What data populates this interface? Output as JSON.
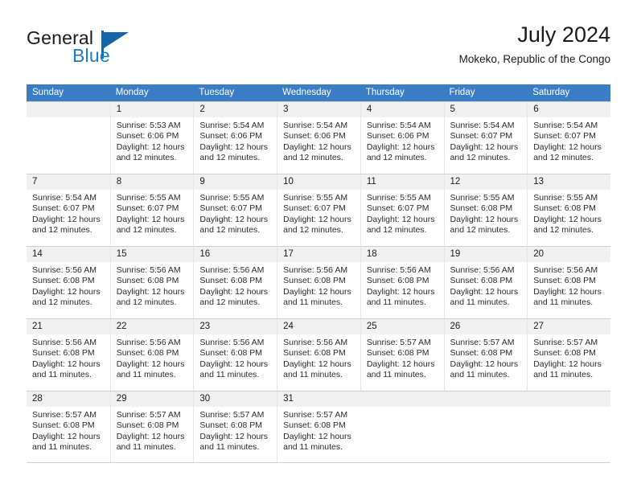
{
  "brand": {
    "name_part1": "General",
    "name_part2": "Blue",
    "logo_icon": "triangle-logo-icon"
  },
  "header": {
    "title": "July 2024",
    "subtitle": "Mokeko, Republic of the Congo"
  },
  "colors": {
    "header_row_background": "#3b7dc4",
    "day_number_background": "#f1f1f1",
    "brand_blue": "#1f7ac4",
    "logo_blue": "#1565a8",
    "text": "#1a1a1a",
    "grid_line": "#d0d0d0"
  },
  "weekday_headers": [
    "Sunday",
    "Monday",
    "Tuesday",
    "Wednesday",
    "Thursday",
    "Friday",
    "Saturday"
  ],
  "labels": {
    "sunrise_prefix": "Sunrise:",
    "sunset_prefix": "Sunset:",
    "daylight_prefix": "Daylight:"
  },
  "weeks": [
    [
      {
        "empty": true
      },
      {
        "day": "1",
        "sunrise": "Sunrise: 5:53 AM",
        "sunset": "Sunset: 6:06 PM",
        "daylight_line1": "Daylight: 12 hours",
        "daylight_line2": "and 12 minutes."
      },
      {
        "day": "2",
        "sunrise": "Sunrise: 5:54 AM",
        "sunset": "Sunset: 6:06 PM",
        "daylight_line1": "Daylight: 12 hours",
        "daylight_line2": "and 12 minutes."
      },
      {
        "day": "3",
        "sunrise": "Sunrise: 5:54 AM",
        "sunset": "Sunset: 6:06 PM",
        "daylight_line1": "Daylight: 12 hours",
        "daylight_line2": "and 12 minutes."
      },
      {
        "day": "4",
        "sunrise": "Sunrise: 5:54 AM",
        "sunset": "Sunset: 6:06 PM",
        "daylight_line1": "Daylight: 12 hours",
        "daylight_line2": "and 12 minutes."
      },
      {
        "day": "5",
        "sunrise": "Sunrise: 5:54 AM",
        "sunset": "Sunset: 6:07 PM",
        "daylight_line1": "Daylight: 12 hours",
        "daylight_line2": "and 12 minutes."
      },
      {
        "day": "6",
        "sunrise": "Sunrise: 5:54 AM",
        "sunset": "Sunset: 6:07 PM",
        "daylight_line1": "Daylight: 12 hours",
        "daylight_line2": "and 12 minutes."
      }
    ],
    [
      {
        "day": "7",
        "sunrise": "Sunrise: 5:54 AM",
        "sunset": "Sunset: 6:07 PM",
        "daylight_line1": "Daylight: 12 hours",
        "daylight_line2": "and 12 minutes."
      },
      {
        "day": "8",
        "sunrise": "Sunrise: 5:55 AM",
        "sunset": "Sunset: 6:07 PM",
        "daylight_line1": "Daylight: 12 hours",
        "daylight_line2": "and 12 minutes."
      },
      {
        "day": "9",
        "sunrise": "Sunrise: 5:55 AM",
        "sunset": "Sunset: 6:07 PM",
        "daylight_line1": "Daylight: 12 hours",
        "daylight_line2": "and 12 minutes."
      },
      {
        "day": "10",
        "sunrise": "Sunrise: 5:55 AM",
        "sunset": "Sunset: 6:07 PM",
        "daylight_line1": "Daylight: 12 hours",
        "daylight_line2": "and 12 minutes."
      },
      {
        "day": "11",
        "sunrise": "Sunrise: 5:55 AM",
        "sunset": "Sunset: 6:07 PM",
        "daylight_line1": "Daylight: 12 hours",
        "daylight_line2": "and 12 minutes."
      },
      {
        "day": "12",
        "sunrise": "Sunrise: 5:55 AM",
        "sunset": "Sunset: 6:08 PM",
        "daylight_line1": "Daylight: 12 hours",
        "daylight_line2": "and 12 minutes."
      },
      {
        "day": "13",
        "sunrise": "Sunrise: 5:55 AM",
        "sunset": "Sunset: 6:08 PM",
        "daylight_line1": "Daylight: 12 hours",
        "daylight_line2": "and 12 minutes."
      }
    ],
    [
      {
        "day": "14",
        "sunrise": "Sunrise: 5:56 AM",
        "sunset": "Sunset: 6:08 PM",
        "daylight_line1": "Daylight: 12 hours",
        "daylight_line2": "and 12 minutes."
      },
      {
        "day": "15",
        "sunrise": "Sunrise: 5:56 AM",
        "sunset": "Sunset: 6:08 PM",
        "daylight_line1": "Daylight: 12 hours",
        "daylight_line2": "and 12 minutes."
      },
      {
        "day": "16",
        "sunrise": "Sunrise: 5:56 AM",
        "sunset": "Sunset: 6:08 PM",
        "daylight_line1": "Daylight: 12 hours",
        "daylight_line2": "and 12 minutes."
      },
      {
        "day": "17",
        "sunrise": "Sunrise: 5:56 AM",
        "sunset": "Sunset: 6:08 PM",
        "daylight_line1": "Daylight: 12 hours",
        "daylight_line2": "and 11 minutes."
      },
      {
        "day": "18",
        "sunrise": "Sunrise: 5:56 AM",
        "sunset": "Sunset: 6:08 PM",
        "daylight_line1": "Daylight: 12 hours",
        "daylight_line2": "and 11 minutes."
      },
      {
        "day": "19",
        "sunrise": "Sunrise: 5:56 AM",
        "sunset": "Sunset: 6:08 PM",
        "daylight_line1": "Daylight: 12 hours",
        "daylight_line2": "and 11 minutes."
      },
      {
        "day": "20",
        "sunrise": "Sunrise: 5:56 AM",
        "sunset": "Sunset: 6:08 PM",
        "daylight_line1": "Daylight: 12 hours",
        "daylight_line2": "and 11 minutes."
      }
    ],
    [
      {
        "day": "21",
        "sunrise": "Sunrise: 5:56 AM",
        "sunset": "Sunset: 6:08 PM",
        "daylight_line1": "Daylight: 12 hours",
        "daylight_line2": "and 11 minutes."
      },
      {
        "day": "22",
        "sunrise": "Sunrise: 5:56 AM",
        "sunset": "Sunset: 6:08 PM",
        "daylight_line1": "Daylight: 12 hours",
        "daylight_line2": "and 11 minutes."
      },
      {
        "day": "23",
        "sunrise": "Sunrise: 5:56 AM",
        "sunset": "Sunset: 6:08 PM",
        "daylight_line1": "Daylight: 12 hours",
        "daylight_line2": "and 11 minutes."
      },
      {
        "day": "24",
        "sunrise": "Sunrise: 5:56 AM",
        "sunset": "Sunset: 6:08 PM",
        "daylight_line1": "Daylight: 12 hours",
        "daylight_line2": "and 11 minutes."
      },
      {
        "day": "25",
        "sunrise": "Sunrise: 5:57 AM",
        "sunset": "Sunset: 6:08 PM",
        "daylight_line1": "Daylight: 12 hours",
        "daylight_line2": "and 11 minutes."
      },
      {
        "day": "26",
        "sunrise": "Sunrise: 5:57 AM",
        "sunset": "Sunset: 6:08 PM",
        "daylight_line1": "Daylight: 12 hours",
        "daylight_line2": "and 11 minutes."
      },
      {
        "day": "27",
        "sunrise": "Sunrise: 5:57 AM",
        "sunset": "Sunset: 6:08 PM",
        "daylight_line1": "Daylight: 12 hours",
        "daylight_line2": "and 11 minutes."
      }
    ],
    [
      {
        "day": "28",
        "sunrise": "Sunrise: 5:57 AM",
        "sunset": "Sunset: 6:08 PM",
        "daylight_line1": "Daylight: 12 hours",
        "daylight_line2": "and 11 minutes."
      },
      {
        "day": "29",
        "sunrise": "Sunrise: 5:57 AM",
        "sunset": "Sunset: 6:08 PM",
        "daylight_line1": "Daylight: 12 hours",
        "daylight_line2": "and 11 minutes."
      },
      {
        "day": "30",
        "sunrise": "Sunrise: 5:57 AM",
        "sunset": "Sunset: 6:08 PM",
        "daylight_line1": "Daylight: 12 hours",
        "daylight_line2": "and 11 minutes."
      },
      {
        "day": "31",
        "sunrise": "Sunrise: 5:57 AM",
        "sunset": "Sunset: 6:08 PM",
        "daylight_line1": "Daylight: 12 hours",
        "daylight_line2": "and 11 minutes."
      },
      {
        "empty": true
      },
      {
        "empty": true
      },
      {
        "empty": true
      }
    ]
  ]
}
